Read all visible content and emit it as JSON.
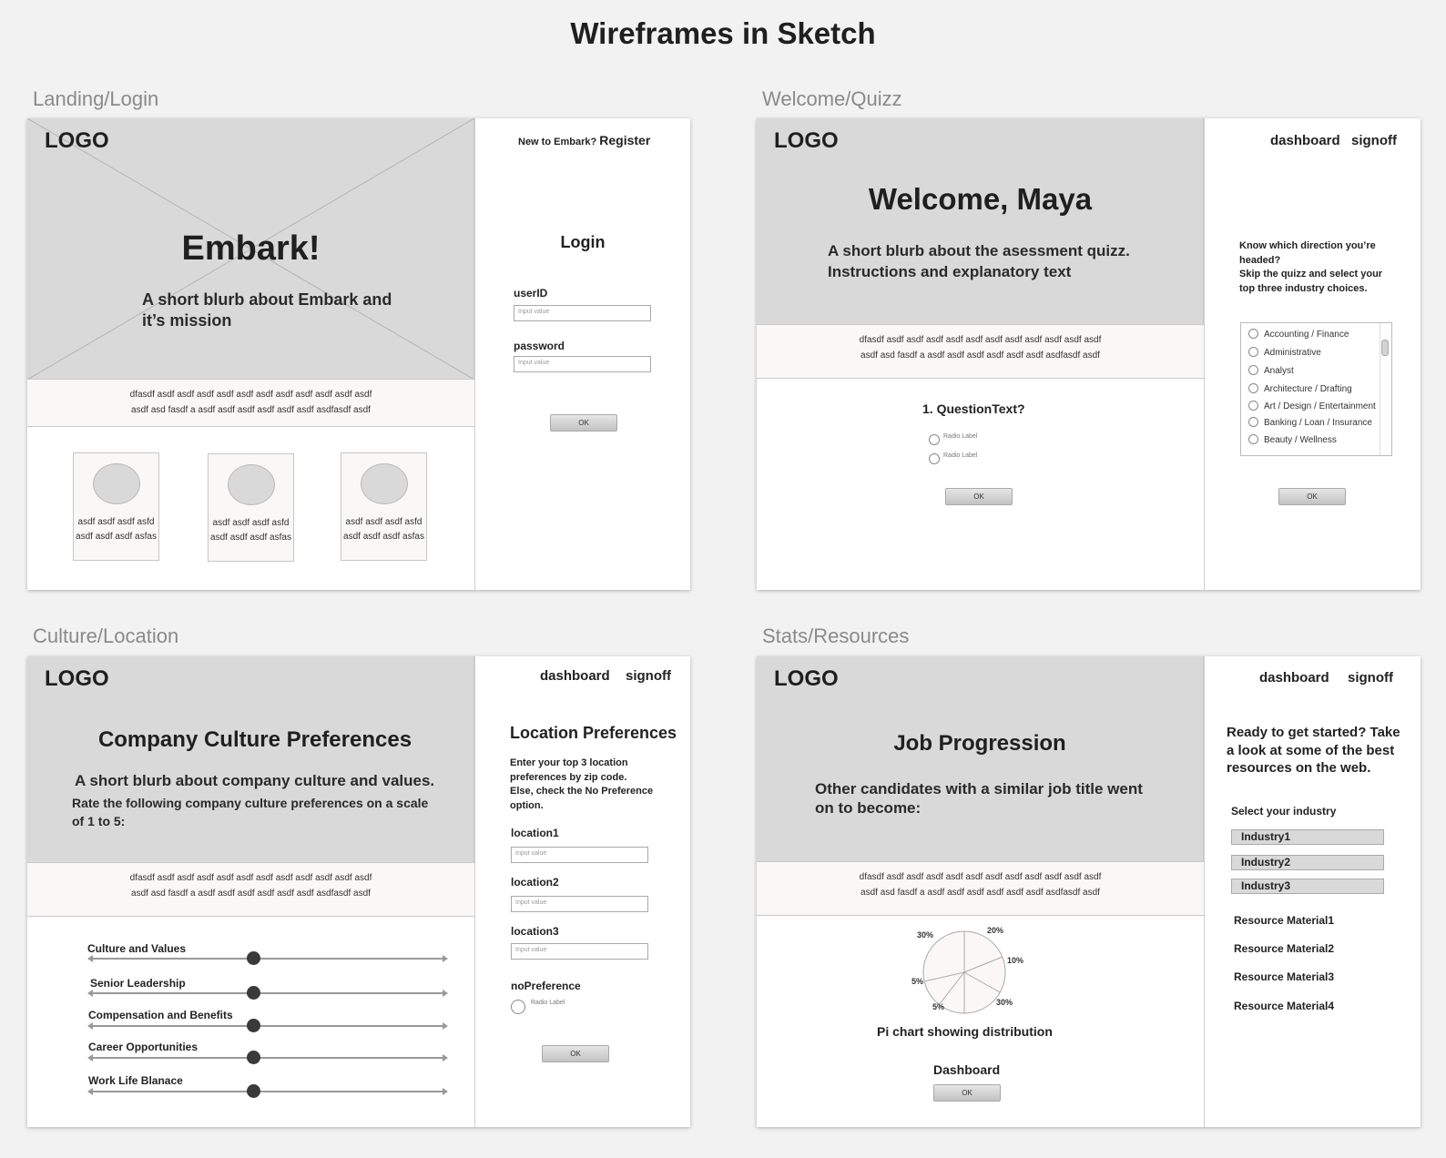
{
  "page_title": "Wireframes in Sketch",
  "common": {
    "logo": "LOGO",
    "strip_line1": "dfasdf asdf asdf  asdf asdf  asdf asdf asdf asdf asdf asdf asdf",
    "strip_line2": "asdf asd fasdf a asdf asdf asdf asdf   asdf asdf asdfasdf asdf",
    "ok": "OK",
    "input_placeholder": "Input value",
    "radio_label": "Radio Label",
    "dashboard": "dashboard",
    "signoff": "signoff"
  },
  "landing": {
    "label": "Landing/Login",
    "hero_title": "Embark!",
    "hero_blurb_line1": "A short blurb about Embark and",
    "hero_blurb_line2": "it’s mission",
    "new_to": "New to Embark?",
    "register": "Register",
    "login_title": "Login",
    "userid_label": "userID",
    "password_label": "password",
    "cards": [
      {
        "line1": "asdf asdf asdf asfd",
        "line2": "asdf asdf asdf asfas"
      },
      {
        "line1": "asdf asdf asdf asfd",
        "line2": "asdf asdf asdf asfas"
      },
      {
        "line1": "asdf asdf asdf asfd",
        "line2": "asdf asdf asdf asfas"
      }
    ]
  },
  "welcome": {
    "label": "Welcome/Quizz",
    "hero_title": "Welcome, Maya",
    "blurb_line1": "A short blurb about the asessment quizz.",
    "blurb_line2": "Instructions and explanatory text",
    "question": "1. QuestionText?",
    "side_text_line1": "Know which direction you’re",
    "side_text_line2": "headed?",
    "side_text_line3": "Skip the quizz and select your",
    "side_text_line4": "top three industry choices.",
    "industries": [
      "Accounting / Finance",
      "Administrative",
      "Analyst",
      "Architecture / Drafting",
      "Art / Design / Entertainment",
      "Banking / Loan / Insurance",
      "Beauty / Wellness"
    ]
  },
  "culture": {
    "label": "Culture/Location",
    "hero_title": "Company Culture Preferences",
    "blurb_line1": "A short blurb about company culture and values.",
    "blurb_line2": "Rate the following company culture preferences on a scale",
    "blurb_line3": "of 1 to 5:",
    "sliders": [
      {
        "label": "Culture and Values",
        "value": 3
      },
      {
        "label": "Senior Leadership",
        "value": 3
      },
      {
        "label": "Compensation and Benefits",
        "value": 3
      },
      {
        "label": "Career Opportunities",
        "value": 3
      },
      {
        "label": "Work Life Blanace",
        "value": 3
      }
    ],
    "loc_title": "Location Preferences",
    "loc_text_line1": "Enter your top 3 location",
    "loc_text_line2": "preferences by zip code.",
    "loc_text_line3": "Else, check the No Preference",
    "loc_text_line4": "option.",
    "location1": "location1",
    "location2": "location2",
    "location3": "location3",
    "no_preference": "noPreference"
  },
  "stats": {
    "label": "Stats/Resources",
    "hero_title": "Job Progression",
    "blurb_line1": "Other candidates with a similar job title went",
    "blurb_line2": "on to become:",
    "pie_caption": "Pi chart showing distribution",
    "dashboard_title": "Dashboard",
    "side_text_line1": "Ready to get started? Take",
    "side_text_line2": "a look at some of the best",
    "side_text_line3": "resources on the web.",
    "select_industry": "Select your industry",
    "industries": [
      "Industry1",
      "Industry2",
      "Industry3"
    ],
    "resources": [
      "Resource Material1",
      "Resource Material2",
      "Resource Material3",
      "Resource Material4"
    ],
    "pie_labels": [
      "30%",
      "20%",
      "10%",
      "5%",
      "5%",
      "30%"
    ]
  }
}
